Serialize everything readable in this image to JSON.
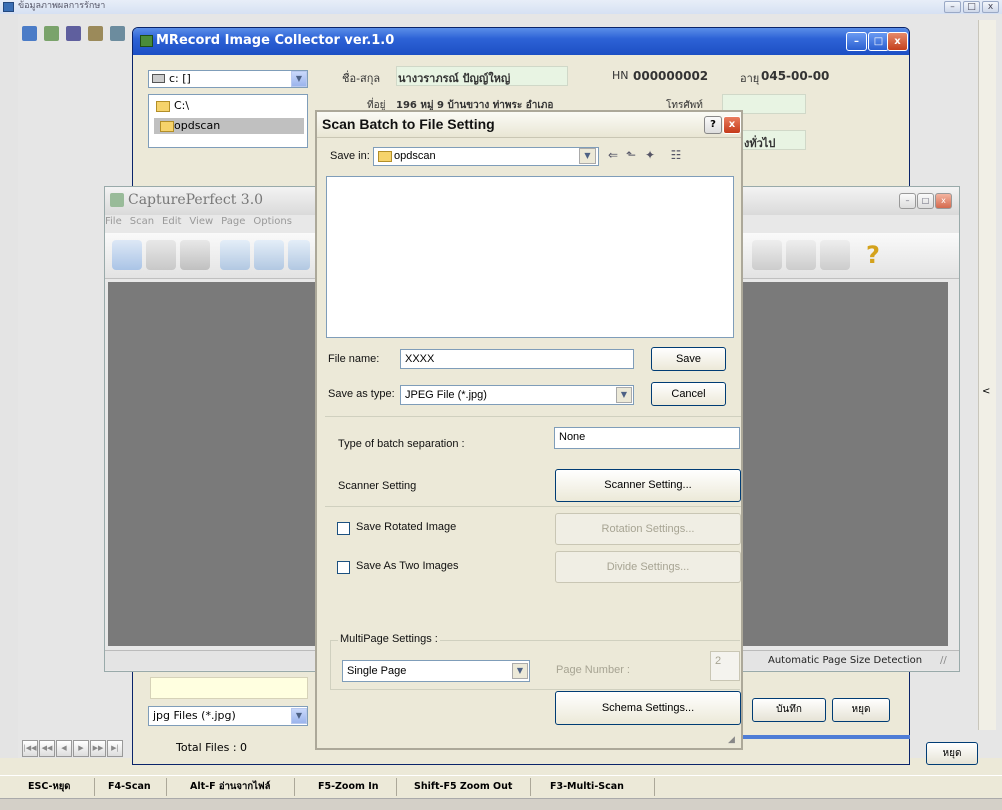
{
  "main": {
    "title": "ข้อมูลภาพผลการรักษา",
    "controls": {
      "min": "–",
      "max": "□",
      "close": "x"
    },
    "scroll_marker": "<",
    "stop_label": "หยุด",
    "fkeys": [
      "ESC-หยุด",
      "F4-Scan",
      "Alt-F อ่านจากไฟล์",
      "F5-Zoom In",
      "Shift-F5 Zoom Out",
      "F3-Multi-Scan"
    ]
  },
  "mrecord": {
    "title": "MRecord Image Collector ver.1.0",
    "drive": "c: []",
    "folders": [
      "C:\\",
      "opdscan"
    ],
    "selected_folder": "opdscan",
    "patient": {
      "name_label": "ชื่อ-สกุล",
      "name_value": "นางวราภรณ์ ปัญญ์ใหญ่",
      "hn_label": "HN",
      "hn_value": "000000002",
      "age_label": "อายุ",
      "age_value": "045-00-00",
      "address_label": "ที่อยู่",
      "address_value": "196 หมู่ 9 บ้านขวาง ท่าพระ อำเภอ",
      "phone_label": "โทรศัพท์",
      "type_value": "งทั่วไป"
    },
    "file_type": "jpg Files (*.jpg)",
    "total_files": "Total Files : 0",
    "save_button": "บันทึก",
    "stop_button": "หยุด"
  },
  "captureperfect": {
    "title": "CapturePerfect 3.0",
    "menu": [
      "File",
      "Scan",
      "Edit",
      "View",
      "Page",
      "Options"
    ],
    "status_prefix": "i",
    "status": "Automatic Page Size Detection",
    "help_icon": "?"
  },
  "dialog": {
    "title": "Scan Batch to File Setting",
    "help": "?",
    "close": "x",
    "save_in_label": "Save in:",
    "save_in_value": "opdscan",
    "file_name_label": "File name:",
    "file_name_value": "XXXX",
    "save_as_label": "Save as type:",
    "save_as_value": "JPEG File (*.jpg)",
    "save_button": "Save",
    "cancel_button": "Cancel",
    "batch_sep_label": "Type of batch separation :",
    "batch_sep_value": "None",
    "scanner_setting_label": "Scanner Setting",
    "scanner_setting_button": "Scanner Setting...",
    "save_rotated_label": "Save Rotated Image",
    "rotation_settings_button": "Rotation Settings...",
    "save_two_label": "Save As Two Images",
    "divide_settings_button": "Divide Settings...",
    "multipage_label": "MultiPage Settings :",
    "multipage_value": "Single Page",
    "page_number_label": "Page Number :",
    "page_number_value": "2",
    "schema_button": "Schema Settings..."
  },
  "colors": {
    "xp_blue": "#2d62d6",
    "dialog_bg": "#ece9d8",
    "canvas_gray": "#7a7a7a"
  }
}
